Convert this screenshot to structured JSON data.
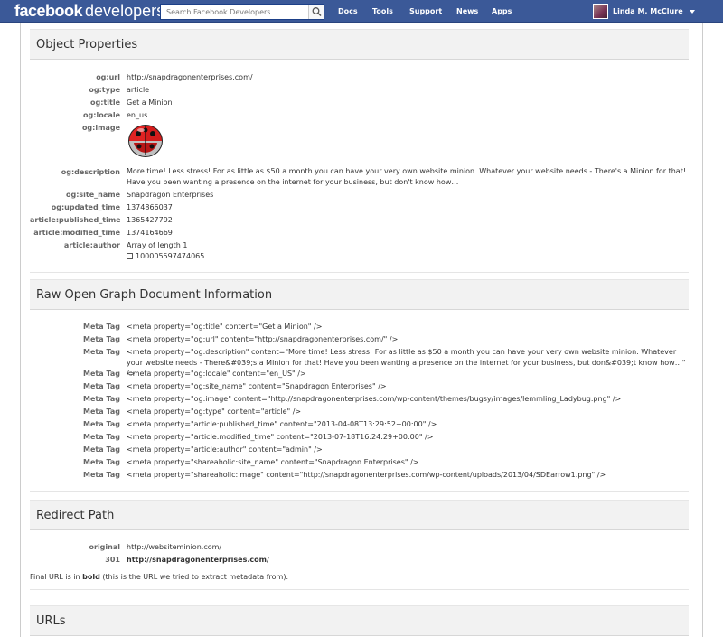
{
  "topbar": {
    "logo_bold": "facebook",
    "logo_rest": "developers",
    "search_placeholder": "Search Facebook Developers",
    "nav": [
      "Docs",
      "Tools",
      "Support",
      "News",
      "Apps"
    ],
    "user_name": "Linda M. McClure"
  },
  "object_properties": {
    "title": "Object Properties",
    "rows": [
      {
        "key": "og:url",
        "value": "http://snapdragonenterprises.com/"
      },
      {
        "key": "og:type",
        "value": "article"
      },
      {
        "key": "og:title",
        "value": "Get a Minion"
      },
      {
        "key": "og:locale",
        "value": "en_us"
      },
      {
        "key": "og:image",
        "value": ""
      },
      {
        "key": "og:description",
        "value": "More time! Less stress! For as little as $50 a month you can have your very own website minion. Whatever your website needs - There's a Minion for that! Have you been wanting a presence on the internet for your business, but don't know how…"
      },
      {
        "key": "og:site_name",
        "value": "Snapdragon Enterprises"
      },
      {
        "key": "og:updated_time",
        "value": "1374866037"
      },
      {
        "key": "article:published_time",
        "value": "1365427792"
      },
      {
        "key": "article:modified_time",
        "value": "1374164669"
      },
      {
        "key": "article:author",
        "value": "Array of length 1"
      }
    ],
    "author_item": "100005597474065"
  },
  "raw_og": {
    "title": "Raw Open Graph Document Information",
    "label": "Meta Tag",
    "tags": [
      "<meta property=\"og:title\" content=\"Get a Minion\" />",
      "<meta property=\"og:url\" content=\"http://snapdragonenterprises.com/\" />",
      "<meta property=\"og:description\" content=\"More time! Less stress! For as little as $50 a month you can have your very own website minion. Whatever your website needs - There&#039;s a Minion for that! Have you been wanting a presence on the internet for your business, but don&#039;t know how…\" />",
      "<meta property=\"og:locale\" content=\"en_US\" />",
      "<meta property=\"og:site_name\" content=\"Snapdragon Enterprises\" />",
      "<meta property=\"og:image\" content=\"http://snapdragonenterprises.com/wp-content/themes/bugsy/images/lemmling_Ladybug.png\" />",
      "<meta property=\"og:type\" content=\"article\" />",
      "<meta property=\"article:published_time\" content=\"2013-04-08T13:29:52+00:00\" />",
      "<meta property=\"article:modified_time\" content=\"2013-07-18T16:24:29+00:00\" />",
      "<meta property=\"article:author\" content=\"admin\" />",
      "<meta property=\"shareaholic:site_name\" content=\"Snapdragon Enterprises\" />",
      "<meta property=\"shareaholic:image\" content=\"http://snapdragonenterprises.com/wp-content/uploads/2013/04/SDEarrow1.png\" />"
    ]
  },
  "redirect": {
    "title": "Redirect Path",
    "original_label": "original",
    "original_url": "http://websiteminion.com/",
    "code_label": "301",
    "final_url": "http://snapdragonenterprises.com/",
    "note_pre": "Final URL is in ",
    "note_bold": "bold",
    "note_post": " (this is the URL we tried to extract metadata from)."
  },
  "urls": {
    "title": "URLs"
  },
  "colors": {
    "topbar": "#3b5998",
    "link": "#3b5998"
  }
}
